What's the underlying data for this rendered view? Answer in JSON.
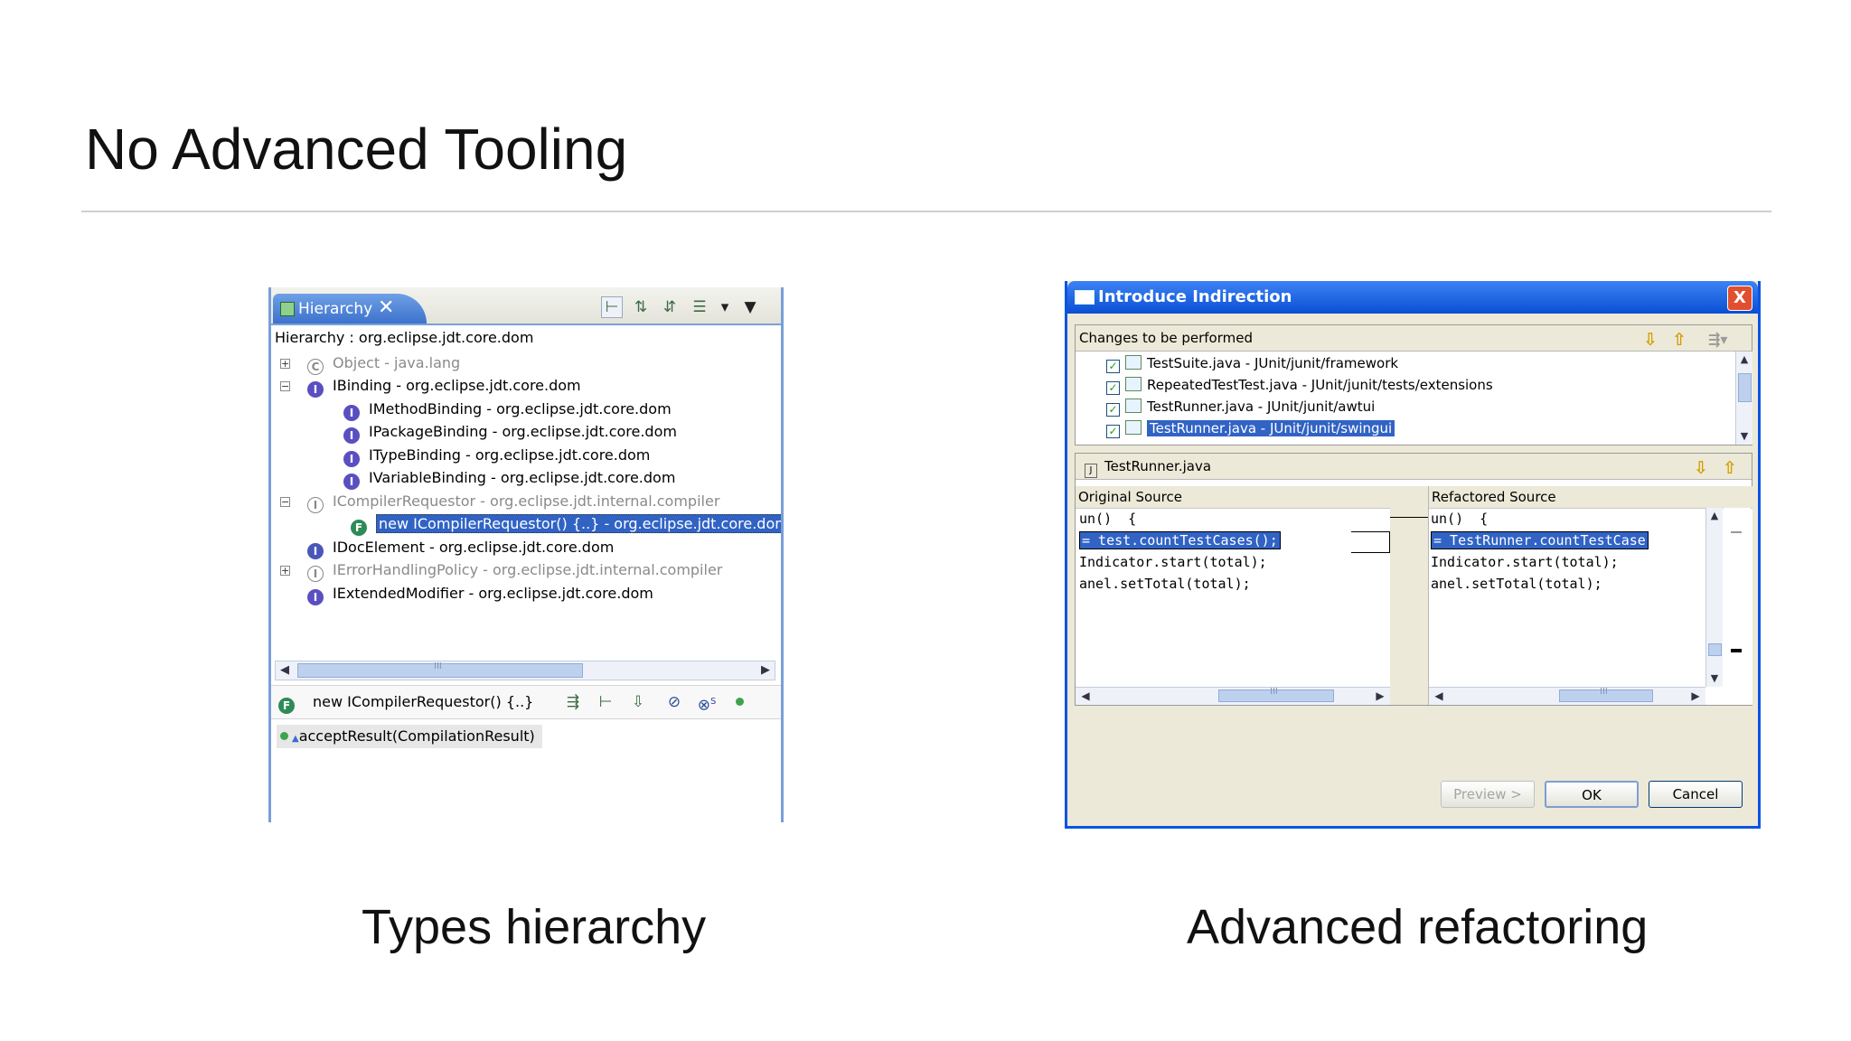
{
  "slide": {
    "title": "No Advanced Tooling",
    "caption_left": "Types hierarchy",
    "caption_right": "Advanced refactoring"
  },
  "hierarchy": {
    "tab_label": "Hierarchy",
    "breadcrumb": "Hierarchy : org.eclipse.jdt.core.dom",
    "items": [
      {
        "label": "Object - java.lang",
        "icon": "C"
      },
      {
        "label": "IBinding - org.eclipse.jdt.core.dom",
        "icon": "I"
      },
      {
        "label": "IMethodBinding - org.eclipse.jdt.core.dom",
        "icon": "I"
      },
      {
        "label": "IPackageBinding - org.eclipse.jdt.core.dom",
        "icon": "I"
      },
      {
        "label": "ITypeBinding - org.eclipse.jdt.core.dom",
        "icon": "I"
      },
      {
        "label": "IVariableBinding - org.eclipse.jdt.core.dom",
        "icon": "I"
      },
      {
        "label": "ICompilerRequestor - org.eclipse.jdt.internal.compiler",
        "icon": "I"
      },
      {
        "label": "new ICompilerRequestor() {..} - org.eclipse.jdt.core.dom",
        "icon": "F"
      },
      {
        "label": "IDocElement - org.eclipse.jdt.core.dom",
        "icon": "I"
      },
      {
        "label": "IErrorHandlingPolicy - org.eclipse.jdt.internal.compiler",
        "icon": "I"
      },
      {
        "label": "IExtendedModifier - org.eclipse.jdt.core.dom",
        "icon": "I"
      }
    ],
    "scroll_thumb": "III",
    "member_label": "new ICompilerRequestor() {..}",
    "member_item": "acceptResult(CompilationResult)",
    "member_badge": "S"
  },
  "dialog": {
    "title": "Introduce Indirection",
    "close": "X",
    "changes_header": "Changes to be performed",
    "changes": [
      "TestSuite.java - JUnit/junit/framework",
      "RepeatedTestTest.java - JUnit/junit/tests/extensions",
      "TestRunner.java - JUnit/junit/awtui",
      "TestRunner.java - JUnit/junit/swingui"
    ],
    "file_label": "TestRunner.java",
    "file_badge": "J",
    "original_header": "Original Source",
    "refactored_header": "Refactored Source",
    "original_lines": [
      "un()  {",
      "= test.countTestCases();",
      "Indicator.start(total);",
      "anel.setTotal(total);"
    ],
    "refactored_lines": [
      "un()  {",
      "= TestRunner.countTestCase",
      "Indicator.start(total);",
      "anel.setTotal(total);"
    ],
    "scroll_thumb": "III",
    "buttons": {
      "preview": "Preview >",
      "ok": "OK",
      "cancel": "Cancel"
    }
  }
}
